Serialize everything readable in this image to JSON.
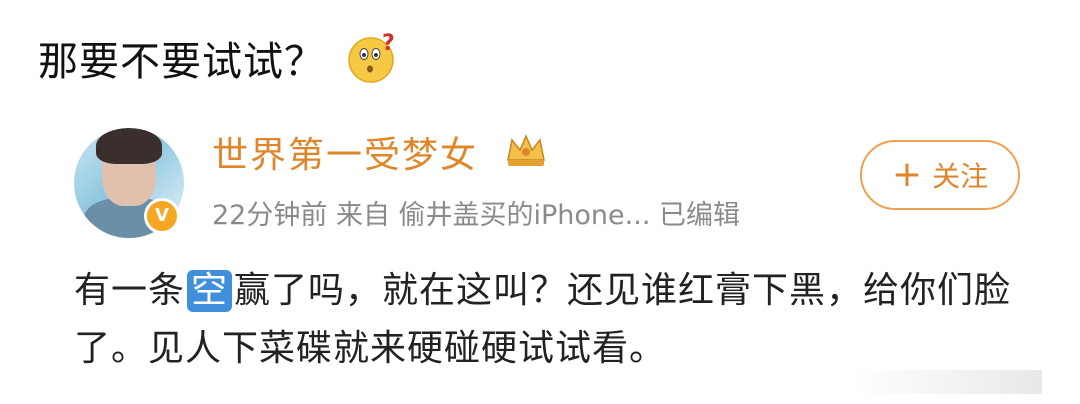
{
  "caption": {
    "text": "那要不要试试？",
    "emoji": "thinking-face-question-emoji"
  },
  "post": {
    "username": "世界第一受梦女",
    "crown_icon": "crown-icon",
    "meta": "22分钟前  来自 偷井盖买的iPhone...  已编辑",
    "follow_label": "关注",
    "follow_plus": "+",
    "verified_badge": "V",
    "body_prefix": "有一条",
    "body_highlight": "空",
    "body_suffix": "赢了吗，就在这叫？还见谁红膏下黑，给你们脸了。见人下菜碟就来硬碰硬试试看。"
  },
  "colors": {
    "accent": "#e0862a",
    "highlight": "#3f8fdc",
    "meta": "#8a8a8a"
  }
}
